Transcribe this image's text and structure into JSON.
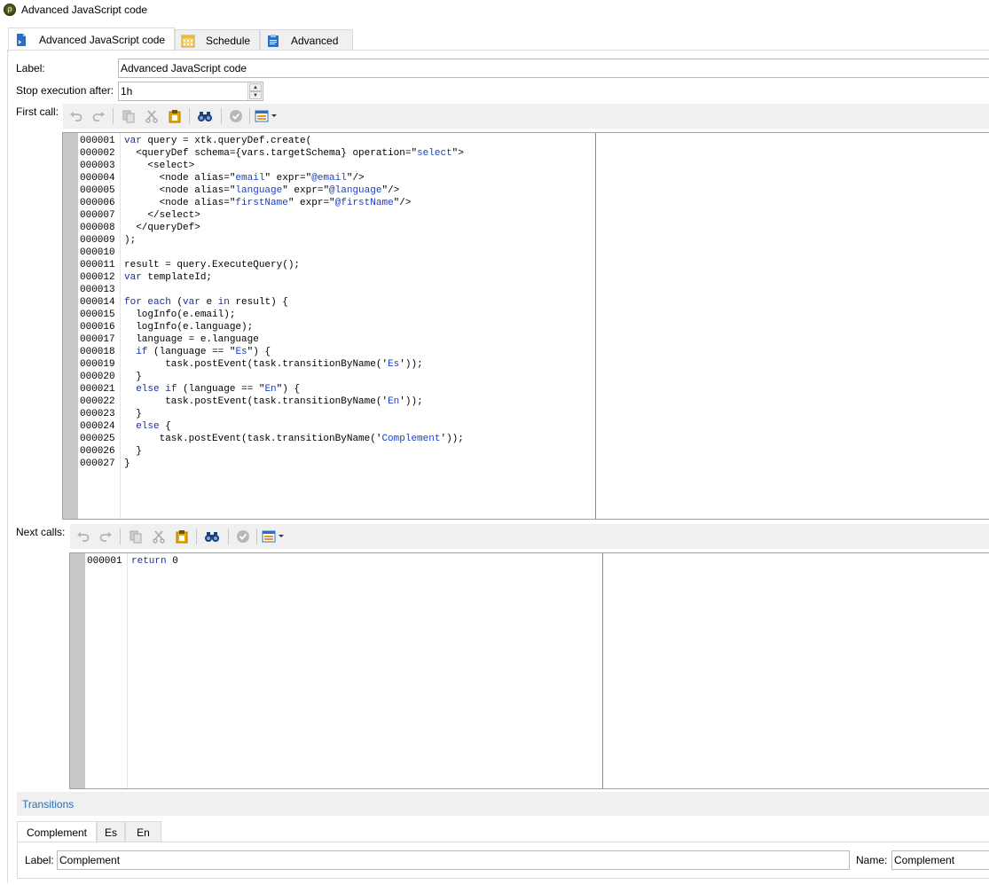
{
  "window": {
    "title": "Advanced JavaScript code"
  },
  "tabs": [
    {
      "label": "Advanced JavaScript code",
      "icon": "js-file-icon"
    },
    {
      "label": "Schedule",
      "icon": "calendar-icon"
    },
    {
      "label": "Advanced",
      "icon": "clipboard-icon"
    }
  ],
  "form": {
    "label_caption": "Label:",
    "label_value": "Advanced JavaScript code",
    "stop_caption": "Stop execution after:",
    "stop_value": "1h"
  },
  "first_call": {
    "caption": "First call:",
    "line_numbers": [
      "000001",
      "000002",
      "000003",
      "000004",
      "000005",
      "000006",
      "000007",
      "000008",
      "000009",
      "000010",
      "000011",
      "000012",
      "000013",
      "000014",
      "000015",
      "000016",
      "000017",
      "000018",
      "000019",
      "000020",
      "000021",
      "000022",
      "000023",
      "000024",
      "000025",
      "000026",
      "000027"
    ],
    "code": [
      "var query = xtk.queryDef.create(",
      "  <queryDef schema={vars.targetSchema} operation=\"select\">",
      "    <select>",
      "      <node alias=\"email\" expr=\"@email\"/>",
      "      <node alias=\"language\" expr=\"@language\"/>",
      "      <node alias=\"firstName\" expr=\"@firstName\"/>",
      "    </select>",
      "  </queryDef>",
      ");",
      "",
      "result = query.ExecuteQuery();",
      "var templateId;",
      "",
      "for each (var e in result) {",
      "  logInfo(e.email);",
      "  logInfo(e.language);",
      "  language = e.language",
      "  if (language == \"Es\") {",
      "       task.postEvent(task.transitionByName('Es'));",
      "  }",
      "  else if (language == \"En\") {",
      "       task.postEvent(task.transitionByName('En'));",
      "  }",
      "  else {",
      "      task.postEvent(task.transitionByName('Complement'));",
      "  }",
      "}"
    ]
  },
  "next_calls": {
    "caption": "Next calls:",
    "line_numbers": [
      "000001"
    ],
    "code": [
      "return 0"
    ]
  },
  "transitions": {
    "title": "Transitions",
    "tabs": [
      "Complement",
      "Es",
      "En"
    ],
    "label_caption": "Label:",
    "label_value": "Complement",
    "name_caption": "Name:",
    "name_value": "Complement"
  },
  "colors": {
    "keyword": "#1a2fa0",
    "string": "#1a3fc8",
    "link": "#2a6fb8"
  }
}
